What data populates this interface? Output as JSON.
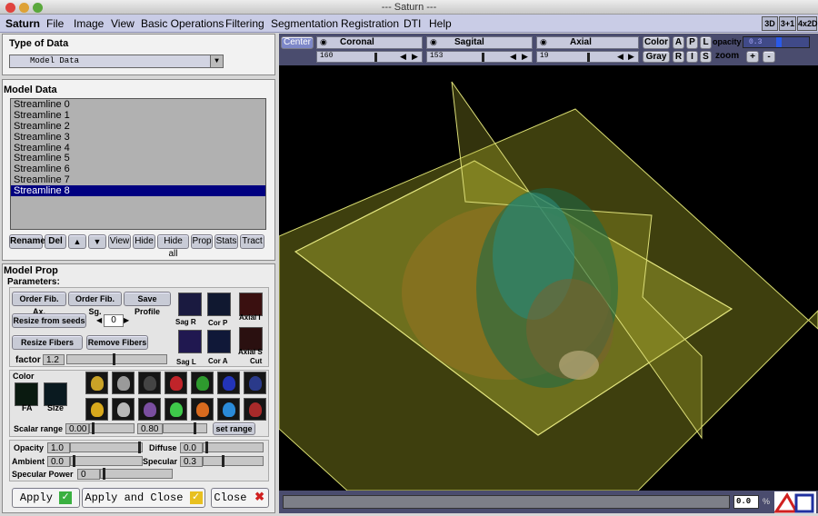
{
  "window": {
    "title": "--- Saturn ---"
  },
  "menu": {
    "app": "Saturn",
    "items": [
      "File",
      "Image",
      "View",
      "Basic Operations",
      "Filtering",
      "Segmentation",
      "Registration",
      "DTI",
      "Help"
    ]
  },
  "view_buttons": [
    "3D",
    "3+1",
    "4x2D"
  ],
  "type_of_data": {
    "heading": "Type of Data",
    "selected": "Model Data"
  },
  "model_data": {
    "heading": "Model Data",
    "items": [
      "Streamline 0",
      "Streamline 1",
      "Streamline 2",
      "Streamline 3",
      "Streamline 4",
      "Streamline 5",
      "Streamline 6",
      "Streamline 7",
      "Streamline 8"
    ],
    "selected_index": 8,
    "buttons": [
      "Rename",
      "Del",
      "View",
      "Hide",
      "Hide all",
      "Prop",
      "Stats",
      "Tract"
    ]
  },
  "model_prop": {
    "heading": "Model Prop",
    "parameters": "Parameters:",
    "order_fib_ax": "Order Fib. Ax.",
    "order_fib_sg": "Order Fib. Sg.",
    "save_profile": "Save Profile",
    "resize_from_seeds": "Resize from seeds",
    "seed_value": "0",
    "resize_fibers": "Resize Fibers",
    "remove_fibers": "Remove Fibers",
    "factor_label": "factor",
    "factor_value": "1.2",
    "views": [
      "Sag R",
      "Cor P",
      "Axial I",
      "Sag L",
      "Cor A",
      "Axial S"
    ],
    "cut_label": "Cut",
    "color_label": "Color",
    "fa_label": "FA",
    "size_label": "Size",
    "scalar_range_label": "Scalar range",
    "scalar_min": "0.00",
    "scalar_max": "0.80",
    "set_range": "set range",
    "opacity_label": "Opacity",
    "opacity_value": "1.0",
    "diffuse_label": "Diffuse",
    "diffuse_value": "0.0",
    "ambient_label": "Ambient",
    "ambient_value": "0.0",
    "specular_label": "Specular",
    "specular_value": "0.3",
    "specular_power_label": "Specular Power",
    "specular_power_value": "0",
    "swatch_colors_row1": [
      "#c9a227",
      "#9a9a9a",
      "#444444",
      "#c0242a",
      "#2e9a2e",
      "#2334b8",
      "#2a3a8a"
    ],
    "swatch_colors_row2": [
      "#d8a81c",
      "#b8b8b8",
      "#7a4ea0",
      "#3ec84a",
      "#d86a1e",
      "#2a8ad8",
      "#a82a2a"
    ]
  },
  "footer": {
    "apply": "Apply",
    "apply_close": "Apply and Close",
    "close": "Close"
  },
  "viewer": {
    "center": "Center",
    "coronal": "Coronal",
    "sagital": "Sagital",
    "axial": "Axial",
    "coronal_val": "160",
    "sagital_val": "153",
    "axial_val": "19",
    "color": "Color",
    "gray": "Gray",
    "a": "A",
    "p": "P",
    "l": "L",
    "r": "R",
    "i": "I",
    "s": "S",
    "opacity_label": "opacity",
    "opacity_val": "0.3",
    "zoom_label": "zoom",
    "zoom_in": "+",
    "zoom_out": "-",
    "status_val": "0.0",
    "status_unit": "%"
  }
}
